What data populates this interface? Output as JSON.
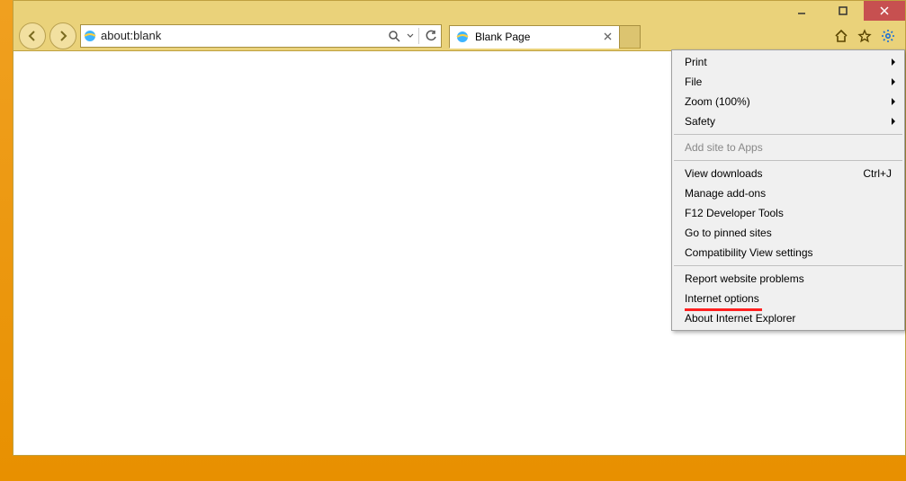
{
  "window": {
    "caption_minimize": "–",
    "caption_maximize": "▢",
    "caption_close": "✕"
  },
  "toolbar": {
    "address": "about:blank",
    "search_tooltip": "Search",
    "refresh_tooltip": "Refresh"
  },
  "tab": {
    "title": "Blank Page"
  },
  "menu": {
    "print": "Print",
    "file": "File",
    "zoom": "Zoom (100%)",
    "safety": "Safety",
    "add_site": "Add site to Apps",
    "view_downloads": "View downloads",
    "view_downloads_shortcut": "Ctrl+J",
    "manage_addons": "Manage add-ons",
    "f12": "F12 Developer Tools",
    "pinned": "Go to pinned sites",
    "compat": "Compatibility View settings",
    "report": "Report website problems",
    "internet_options": "Internet options",
    "about": "About Internet Explorer"
  }
}
